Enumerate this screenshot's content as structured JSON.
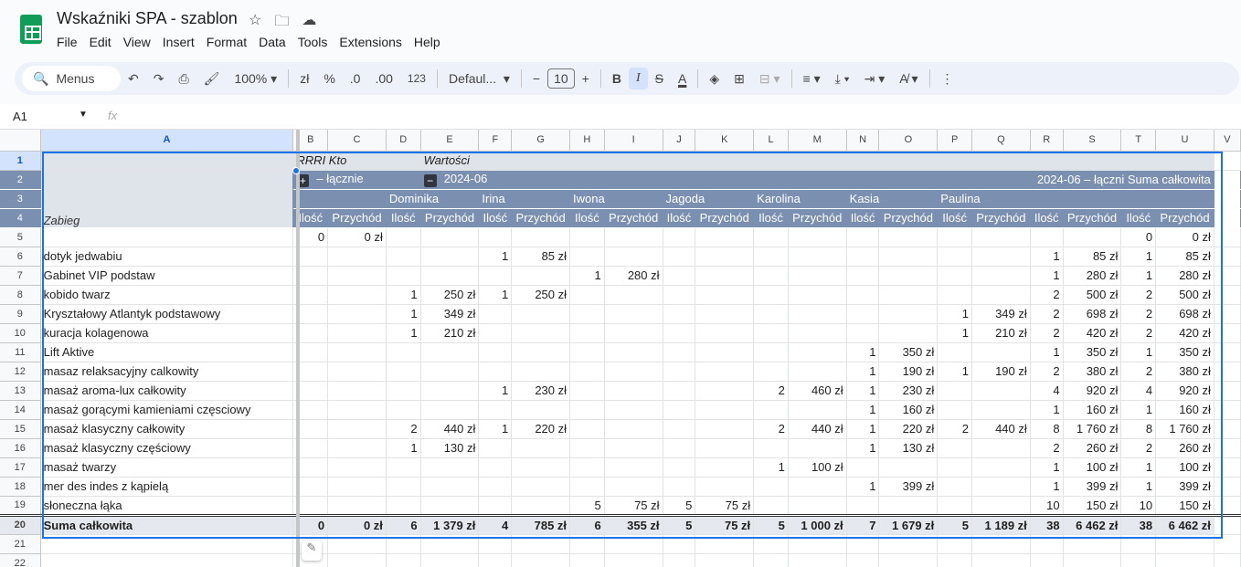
{
  "doc": {
    "title": "Wskaźniki SPA - szablon"
  },
  "menu": [
    "File",
    "Edit",
    "View",
    "Insert",
    "Format",
    "Data",
    "Tools",
    "Extensions",
    "Help"
  ],
  "toolbar": {
    "search": "Menus",
    "zoom": "100%",
    "currency": "zł",
    "percent": "%",
    "dec_less": ".0",
    "dec_more": ".00",
    "format123": "123",
    "font": "Defaul...",
    "font_size": "10"
  },
  "formula_bar": {
    "cell": "A1",
    "fx": "fx",
    "value": ""
  },
  "columns": [
    "A",
    "B",
    "C",
    "D",
    "E",
    "F",
    "G",
    "H",
    "I",
    "J",
    "K",
    "L",
    "M",
    "N",
    "O",
    "P",
    "Q",
    "R",
    "S",
    "T",
    "U",
    "V"
  ],
  "pivot": {
    "row1_a": "RRRI Kto",
    "row1_b": "Wartości",
    "expand_label": "– łącznie",
    "collapse_label": "2024-06",
    "grand_total": "2024-06 – łączni Suma całkowita",
    "row_field": "Zabieg",
    "people": [
      "Dominika",
      "Irina",
      "Iwona",
      "Jagoda",
      "Karolina",
      "Kasia",
      "Paulina"
    ],
    "qty": "Ilość",
    "rev": "Przychód"
  },
  "rows": [
    [
      "",
      "0",
      "0 zł",
      "",
      "",
      "",
      "",
      "",
      "",
      "",
      "",
      "",
      "",
      "",
      "",
      "",
      "",
      "",
      "",
      "0",
      "0 zł"
    ],
    [
      "dotyk jedwabiu",
      "",
      "",
      "",
      "",
      "1",
      "85 zł",
      "",
      "",
      "",
      "",
      "",
      "",
      "",
      "",
      "",
      "",
      "1",
      "85 zł",
      "1",
      "85 zł"
    ],
    [
      "Gabinet VIP podstaw",
      "",
      "",
      "",
      "",
      "",
      "",
      "1",
      "280 zł",
      "",
      "",
      "",
      "",
      "",
      "",
      "",
      "",
      "1",
      "280 zł",
      "1",
      "280 zł"
    ],
    [
      "kobido twarz",
      "",
      "",
      "1",
      "250 zł",
      "1",
      "250 zł",
      "",
      "",
      "",
      "",
      "",
      "",
      "",
      "",
      "",
      "",
      "2",
      "500 zł",
      "2",
      "500 zł"
    ],
    [
      "Kryształowy Atlantyk podstawowy",
      "",
      "",
      "1",
      "349 zł",
      "",
      "",
      "",
      "",
      "",
      "",
      "",
      "",
      "",
      "",
      "1",
      "349 zł",
      "2",
      "698 zł",
      "2",
      "698 zł"
    ],
    [
      "kuracja kolagenowa",
      "",
      "",
      "1",
      "210 zł",
      "",
      "",
      "",
      "",
      "",
      "",
      "",
      "",
      "",
      "",
      "1",
      "210 zł",
      "2",
      "420 zł",
      "2",
      "420 zł"
    ],
    [
      "Lift Aktive",
      "",
      "",
      "",
      "",
      "",
      "",
      "",
      "",
      "",
      "",
      "",
      "",
      "1",
      "350 zł",
      "",
      "",
      "1",
      "350 zł",
      "1",
      "350 zł"
    ],
    [
      "masaz relaksacyjny calkowity",
      "",
      "",
      "",
      "",
      "",
      "",
      "",
      "",
      "",
      "",
      "",
      "",
      "1",
      "190 zł",
      "1",
      "190 zł",
      "2",
      "380 zł",
      "2",
      "380 zł"
    ],
    [
      "masaż aroma-lux całkowity",
      "",
      "",
      "",
      "",
      "1",
      "230 zł",
      "",
      "",
      "",
      "",
      "2",
      "460 zł",
      "1",
      "230 zł",
      "",
      "",
      "4",
      "920 zł",
      "4",
      "920 zł"
    ],
    [
      "masaż gorącymi kamieniami częsciowy",
      "",
      "",
      "",
      "",
      "",
      "",
      "",
      "",
      "",
      "",
      "",
      "",
      "1",
      "160 zł",
      "",
      "",
      "1",
      "160 zł",
      "1",
      "160 zł"
    ],
    [
      "masaż klasyczny całkowity",
      "",
      "",
      "2",
      "440 zł",
      "1",
      "220 zł",
      "",
      "",
      "",
      "",
      "2",
      "440 zł",
      "1",
      "220 zł",
      "2",
      "440 zł",
      "8",
      "1 760 zł",
      "8",
      "1 760 zł"
    ],
    [
      "masaż klasyczny częściowy",
      "",
      "",
      "1",
      "130 zł",
      "",
      "",
      "",
      "",
      "",
      "",
      "",
      "",
      "1",
      "130 zł",
      "",
      "",
      "2",
      "260 zł",
      "2",
      "260 zł"
    ],
    [
      "masaż twarzy",
      "",
      "",
      "",
      "",
      "",
      "",
      "",
      "",
      "",
      "",
      "1",
      "100 zł",
      "",
      "",
      "",
      "",
      "1",
      "100 zł",
      "1",
      "100 zł"
    ],
    [
      "mer des indes z kąpielą",
      "",
      "",
      "",
      "",
      "",
      "",
      "",
      "",
      "",
      "",
      "",
      "",
      "1",
      "399 zł",
      "",
      "",
      "1",
      "399 zł",
      "1",
      "399 zł"
    ],
    [
      "słoneczna łąka",
      "",
      "",
      "",
      "",
      "",
      "",
      "5",
      "75 zł",
      "5",
      "75 zł",
      "",
      "",
      "",
      "",
      "",
      "",
      "10",
      "150 zł",
      "10",
      "150 zł"
    ]
  ],
  "total": [
    "Suma całkowita",
    "0",
    "0 zł",
    "6",
    "1 379 zł",
    "4",
    "785 zł",
    "6",
    "355 zł",
    "5",
    "75 zł",
    "5",
    "1 000 zł",
    "7",
    "1 679 zł",
    "5",
    "1 189 zł",
    "38",
    "6 462 zł",
    "38",
    "6 462 zł"
  ]
}
